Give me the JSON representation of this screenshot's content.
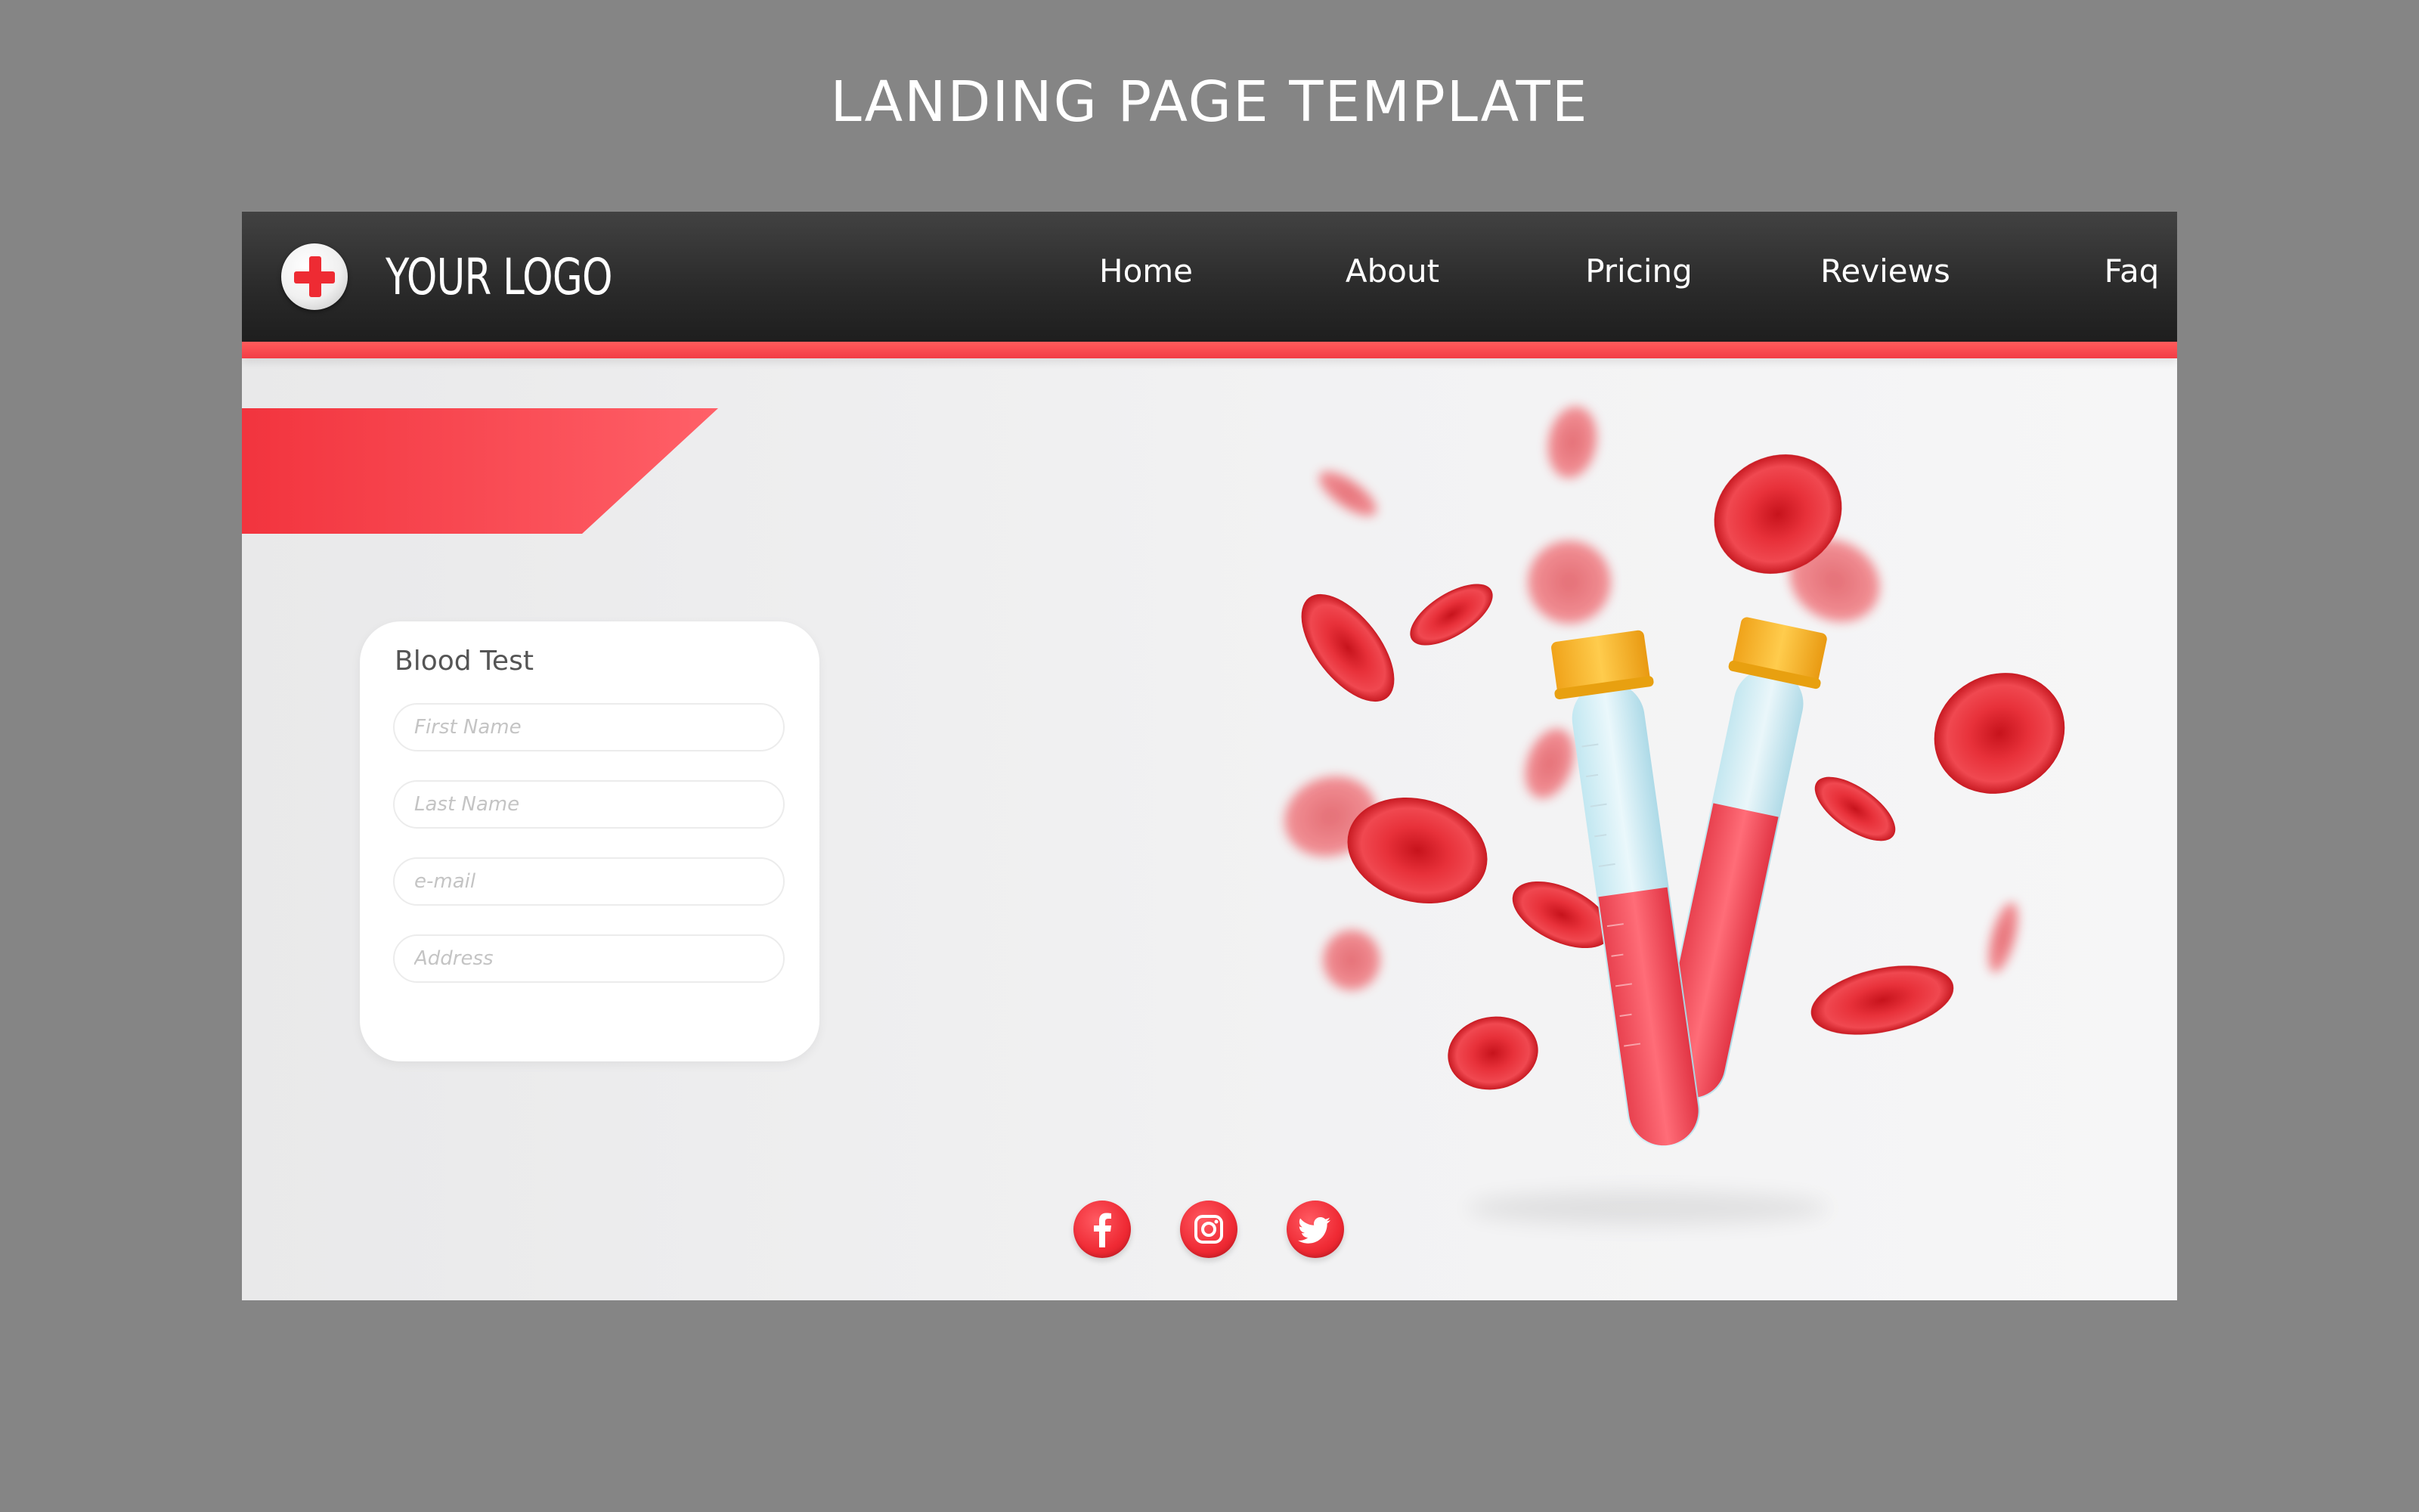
{
  "heading": "LANDING PAGE TEMPLATE",
  "logo": {
    "text": "YOUR LOGO",
    "icon": "red-cross-icon"
  },
  "nav": {
    "items": [
      {
        "label": "Home"
      },
      {
        "label": "About"
      },
      {
        "label": "Pricing"
      },
      {
        "label": "Reviews"
      },
      {
        "label": "Faq"
      }
    ]
  },
  "form": {
    "title": "Blood Test",
    "fields": [
      {
        "placeholder": "First Name",
        "value": ""
      },
      {
        "placeholder": "Last Name",
        "value": ""
      },
      {
        "placeholder": "e-mail",
        "value": ""
      },
      {
        "placeholder": "Address",
        "value": ""
      }
    ]
  },
  "social": [
    {
      "icon": "facebook-icon"
    },
    {
      "icon": "instagram-icon"
    },
    {
      "icon": "twitter-icon"
    }
  ],
  "colors": {
    "background": "#858585",
    "navbar": "#2a2a2a",
    "accent": "#f23c45",
    "card": "#ffffff",
    "tube_cap": "#f5b52a",
    "blood": "#ef4b5a"
  }
}
